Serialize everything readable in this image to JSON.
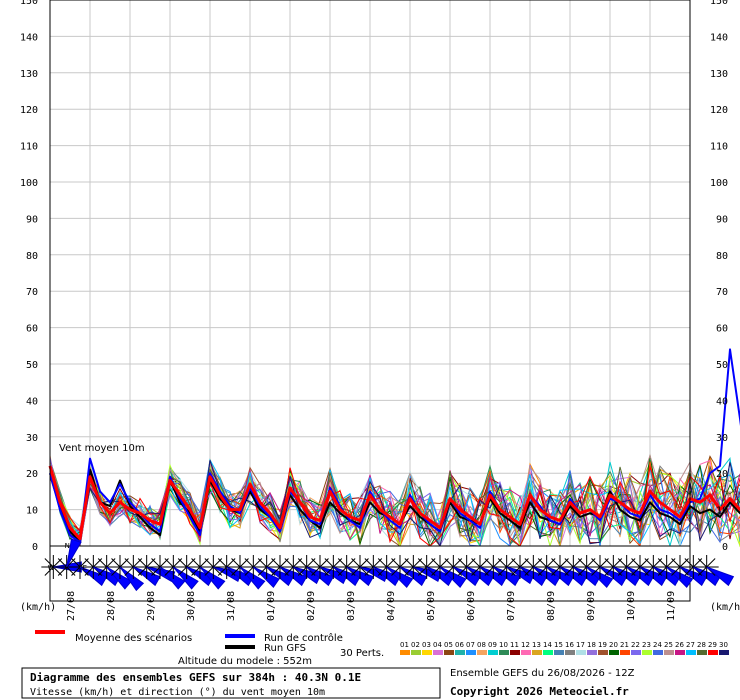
{
  "chart_data": {
    "type": "line",
    "title": "Diagramme des ensembles GEFS sur 384h : 40.3N 0.1E",
    "subtitle": "Vitesse (km/h) et direction (°) du vent moyen 10m",
    "in_plot_label": "Vent moyen 10m",
    "ylabel_left": "(km/h)",
    "ylabel_right": "(km/h)",
    "ylim": [
      0,
      150
    ],
    "yticks": [
      0,
      10,
      20,
      30,
      40,
      50,
      60,
      70,
      80,
      90,
      100,
      110,
      120,
      130,
      140,
      150
    ],
    "x_hours_range": [
      0,
      384
    ],
    "x_step_hours": 6,
    "date_ticks": [
      {
        "label": "27/08",
        "hour": 12
      },
      {
        "label": "28/08",
        "hour": 36
      },
      {
        "label": "29/08",
        "hour": 60
      },
      {
        "label": "30/08",
        "hour": 84
      },
      {
        "label": "31/08",
        "hour": 108
      },
      {
        "label": "01/09",
        "hour": 132
      },
      {
        "label": "02/09",
        "hour": 156
      },
      {
        "label": "03/09",
        "hour": 180
      },
      {
        "label": "04/09",
        "hour": 204
      },
      {
        "label": "05/09",
        "hour": 228
      },
      {
        "label": "06/09",
        "hour": 252
      },
      {
        "label": "07/09",
        "hour": 276
      },
      {
        "label": "08/09",
        "hour": 300
      },
      {
        "label": "09/09",
        "hour": 324
      },
      {
        "label": "10/09",
        "hour": 348
      },
      {
        "label": "11/09",
        "hour": 372
      }
    ],
    "grid": true,
    "series": [
      {
        "name": "Moyenne des scénarios",
        "color": "#ff0000",
        "values": [
          22,
          12,
          5,
          2,
          19,
          12,
          9,
          12,
          10,
          9,
          7,
          6,
          18,
          14,
          10,
          5,
          19,
          14,
          10,
          10,
          17,
          12,
          9,
          5,
          16,
          12,
          8,
          7,
          15,
          10,
          8,
          7,
          14,
          10,
          8,
          6,
          13,
          9,
          7,
          5,
          13,
          10,
          8,
          6,
          14,
          10,
          8,
          6,
          14,
          10,
          8,
          7,
          12,
          9,
          10,
          8,
          14,
          12,
          10,
          9,
          15,
          12,
          10,
          8,
          13,
          12,
          14,
          10,
          13,
          10,
          8,
          9,
          15
        ]
      },
      {
        "name": "Run de contrôle",
        "color": "#0000ff",
        "values": [
          20,
          10,
          3,
          1,
          24,
          15,
          12,
          17,
          12,
          9,
          6,
          4,
          19,
          13,
          8,
          3,
          20,
          15,
          11,
          9,
          16,
          11,
          8,
          4,
          15,
          12,
          7,
          6,
          16,
          11,
          7,
          5,
          15,
          10,
          7,
          5,
          14,
          9,
          6,
          4,
          13,
          9,
          7,
          5,
          15,
          10,
          8,
          6,
          14,
          11,
          7,
          6,
          13,
          9,
          10,
          7,
          13,
          12,
          9,
          8,
          14,
          10,
          9,
          7,
          12,
          13,
          20,
          22,
          54,
          35,
          15,
          10,
          17
        ]
      },
      {
        "name": "Run GFS",
        "color": "#000000",
        "values": [
          20,
          11,
          4,
          1,
          21,
          12,
          11,
          18,
          11,
          8,
          5,
          3,
          18,
          12,
          9,
          4,
          18,
          13,
          10,
          9,
          15,
          10,
          8,
          4,
          14,
          10,
          7,
          5,
          12,
          9,
          7,
          6,
          12,
          9,
          8,
          6,
          11,
          8,
          6,
          4,
          12,
          8,
          7,
          6,
          13,
          9,
          7,
          5,
          12,
          8,
          7,
          6,
          11,
          8,
          9,
          8,
          15,
          10,
          8,
          7,
          12,
          9,
          8,
          6,
          11,
          9,
          10,
          8,
          12,
          9,
          7,
          6,
          10
        ]
      }
    ],
    "perturbations": {
      "count": 30,
      "label": "30 Perts."
    },
    "perturbation_legend": [
      "01",
      "02",
      "03",
      "04",
      "05",
      "06",
      "07",
      "08",
      "09",
      "10",
      "11",
      "12",
      "13",
      "14",
      "15",
      "16",
      "17",
      "18",
      "19",
      "20",
      "21",
      "22",
      "23",
      "24",
      "25",
      "26",
      "27",
      "28",
      "29",
      "30"
    ],
    "perturbation_colors": [
      "#ff8c00",
      "#9acd32",
      "#ffd700",
      "#da70d6",
      "#8b4513",
      "#20b2aa",
      "#1e90ff",
      "#f4a460",
      "#00ced1",
      "#2e8b57",
      "#8b0000",
      "#ff69b4",
      "#daa520",
      "#00ff7f",
      "#4682b4",
      "#808080",
      "#b0e0e6",
      "#9370db",
      "#a0522d",
      "#006400",
      "#ff4500",
      "#7b68ee",
      "#adff2f",
      "#4169e1",
      "#bc8f8f",
      "#c71585",
      "#00bfff",
      "#556b2f",
      "#ff0000",
      "#191970"
    ],
    "wind_directions_deg": [
      270,
      200,
      300,
      300,
      310,
      315,
      300,
      290,
      310,
      310,
      300,
      310,
      290,
      300,
      310,
      305,
      300,
      300,
      295,
      300,
      295,
      300,
      300,
      290,
      300,
      305,
      300,
      290,
      300,
      305,
      300,
      300,
      300,
      300,
      295,
      300,
      300,
      300,
      300,
      300,
      305,
      300,
      300,
      300,
      300,
      300,
      305,
      300,
      300,
      300
    ],
    "compass_letters": [
      "N",
      "W",
      "E"
    ],
    "legend_placement": "bottom"
  },
  "footer": {
    "altitude": "Altitude du modele : 552m",
    "run_info": "Ensemble GEFS du 26/08/2026 - 12Z",
    "copyright": "Copyright 2026 Meteociel.fr"
  }
}
